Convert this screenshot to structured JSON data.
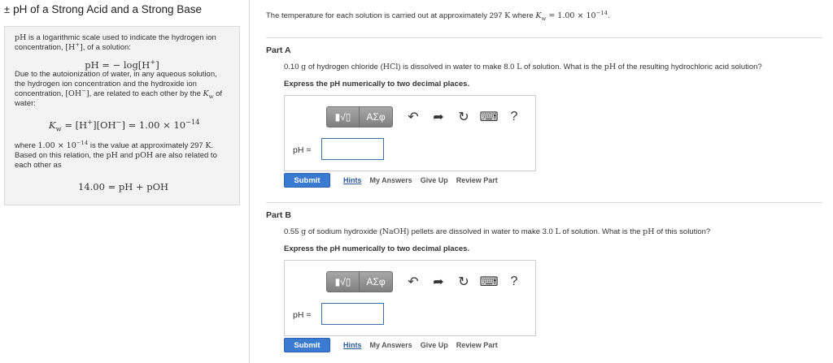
{
  "left": {
    "title_symbol": "±",
    "title": "pH of a Strong Acid and a Strong Base",
    "intro_a": "pH",
    "intro_b": " is a logarithmic scale used to indicate the hydrogen ion concentration, ",
    "intro_c": "[H",
    "intro_d": "+",
    "intro_e": "]",
    "intro_f": ", of a solution:",
    "eq1": "pH = − log[H",
    "eq1_sup": "+",
    "eq1_end": "]",
    "p2_a": "Due to the autoionization of water, in any aqueous solution, the hydrogen ion concentration and the hydroxide ion concentration, ",
    "p2_b": "[OH",
    "p2_c": "−",
    "p2_d": "]",
    "p2_e": ", are related to each other by the ",
    "p2_f": "K",
    "p2_g": "w",
    "p2_h": " of water:",
    "eq2_a": "K",
    "eq2_b": "w",
    "eq2_c": " = [H",
    "eq2_d": "+",
    "eq2_e": "][OH",
    "eq2_f": "−",
    "eq2_g": "] = 1.00 × 10",
    "eq2_h": "−14",
    "p3_a": "where ",
    "p3_b": "1.00 × 10",
    "p3_c": "−14",
    "p3_d": " is the value at approximately 297 ",
    "p3_e": "K",
    "p3_f": ". Based on this relation, the ",
    "p3_g": "pH",
    "p3_h": " and ",
    "p3_i": "pOH",
    "p3_j": " are also related to each other as",
    "eq3": "14.00 = pH + pOH"
  },
  "right": {
    "intro_a": "The temperature for each solution is carried out at approximately 297 ",
    "intro_b": "K",
    "intro_c": " where ",
    "intro_d": "K",
    "intro_e": "w",
    "intro_f": " = 1.00 × 10",
    "intro_g": "−14",
    "intro_h": ".",
    "toolbar": {
      "templates": "▮√▯",
      "symbols": "ΑΣφ",
      "undo": "↶",
      "redo": "➦",
      "reset": "↻",
      "keyboard": "⌨",
      "help": "?"
    },
    "actions": {
      "submit": "Submit",
      "hints": "Hints",
      "my_answers": "My Answers",
      "give_up": "Give Up",
      "review": "Review Part"
    },
    "ans_label": "pH =",
    "partA": {
      "label": "Part A",
      "q_a": "0.10 ",
      "q_b": "g",
      "q_c": " of hydrogen chloride (",
      "q_d": "HCl",
      "q_e": ") is dissolved in water to make 8.0 ",
      "q_f": "L",
      "q_g": "  of solution. What is the ",
      "q_h": "pH",
      "q_i": " of the resulting hydrochloric acid solution?",
      "instruction": "Express the pH numerically to two decimal places.",
      "value": ""
    },
    "partB": {
      "label": "Part B",
      "q_a": "0.55 ",
      "q_b": "g",
      "q_c": " of sodium hydroxide (",
      "q_d": "NaOH",
      "q_e": ") pellets are dissolved in water to make 3.0 ",
      "q_f": "L",
      "q_g": " of solution. What is the ",
      "q_h": "pH",
      "q_i": " of this solution?",
      "instruction": "Express the pH numerically to two decimal places.",
      "value": ""
    }
  }
}
